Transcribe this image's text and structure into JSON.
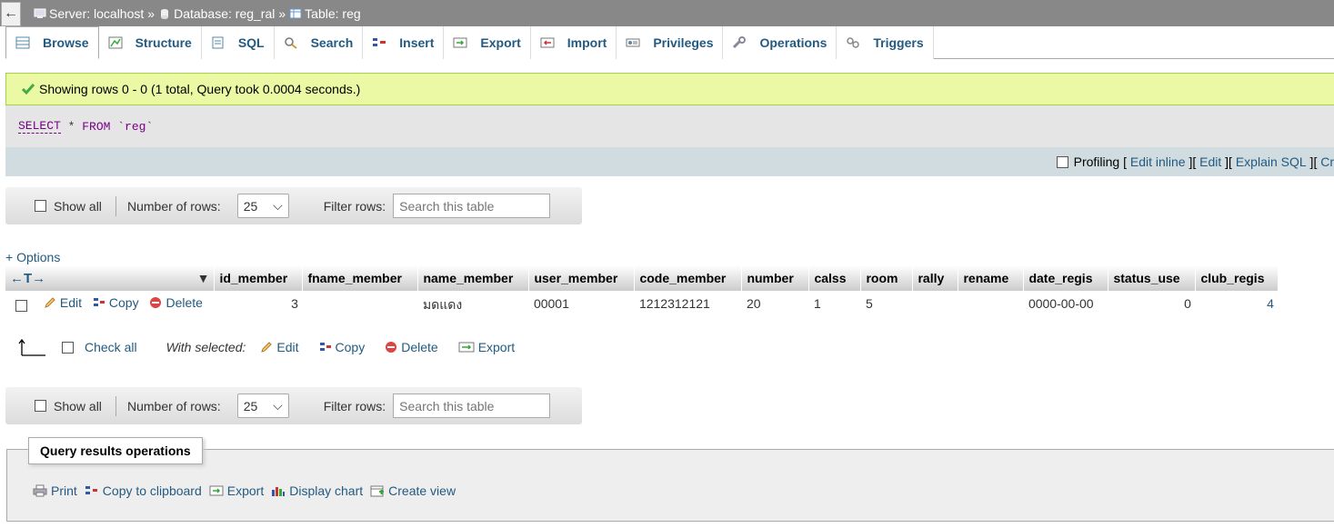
{
  "breadcrumb": {
    "back_label": "←",
    "server": "Server: localhost",
    "database": "Database: reg_ral",
    "table": "Table: reg",
    "sep": "»"
  },
  "tabs": [
    {
      "label": "Browse",
      "icon": "browse-icon"
    },
    {
      "label": "Structure",
      "icon": "structure-icon"
    },
    {
      "label": "SQL",
      "icon": "sql-icon"
    },
    {
      "label": "Search",
      "icon": "search-icon"
    },
    {
      "label": "Insert",
      "icon": "insert-icon"
    },
    {
      "label": "Export",
      "icon": "export-icon"
    },
    {
      "label": "Import",
      "icon": "import-icon"
    },
    {
      "label": "Privileges",
      "icon": "privileges-icon"
    },
    {
      "label": "Operations",
      "icon": "operations-icon"
    },
    {
      "label": "Triggers",
      "icon": "triggers-icon"
    }
  ],
  "message": "Showing rows 0 - 0 (1 total, Query took 0.0004 seconds.)",
  "sql": {
    "select": "SELECT",
    "rest1": " * ",
    "from": "FROM",
    "rest2": " `reg`"
  },
  "sql_actions": {
    "profiling": "Profiling",
    "edit_inline": "Edit inline",
    "edit": "Edit",
    "explain": "Explain SQL",
    "create": "Cr",
    "open": "[ ",
    "close": " ]"
  },
  "nav": {
    "show_all": "Show all",
    "rows_label": "Number of rows:",
    "rows_value": "25",
    "filter_label": "Filter rows:",
    "search_placeholder": "Search this table"
  },
  "options_link": "+ Options",
  "table": {
    "columns": [
      "id_member",
      "fname_member",
      "name_member",
      "user_member",
      "code_member",
      "number",
      "calss",
      "room",
      "rally",
      "rename",
      "date_regis",
      "status_use",
      "club_regis"
    ],
    "row": {
      "edit": "Edit",
      "copy": "Copy",
      "delete": "Delete",
      "cells": [
        "3",
        "",
        "มดแดง",
        "00001",
        "1212312121",
        "20",
        "1",
        "5",
        "",
        "",
        "0000-00-00",
        "0",
        "4"
      ]
    }
  },
  "with_selected": {
    "check_all": "Check all",
    "label": "With selected:",
    "edit": "Edit",
    "copy": "Copy",
    "delete": "Delete",
    "export": "Export"
  },
  "query_ops": {
    "legend": "Query results operations",
    "print": "Print",
    "copy": "Copy to clipboard",
    "export": "Export",
    "chart": "Display chart",
    "view": "Create view"
  },
  "colors": {
    "link": "#235a81",
    "success_bg": "#ebf8a4",
    "success_border": "#a2d246"
  }
}
